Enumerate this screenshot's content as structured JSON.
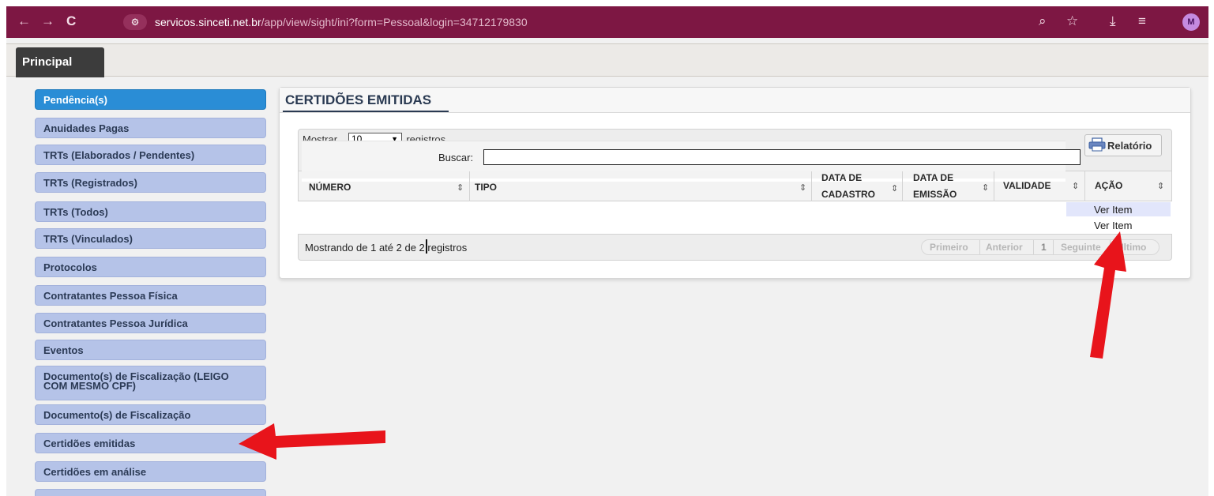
{
  "browser": {
    "url_host": "servicos.sinceti.net.br",
    "url_path": "/app/view/sight/ini?form=Pessoal&login=34712179830",
    "avatar_letter": "M",
    "colors": {
      "chrome": "#7d1743"
    }
  },
  "app": {
    "main_tab": "Principal"
  },
  "sidebar": {
    "items": [
      {
        "label": "Pendência(s)",
        "active": true
      },
      {
        "label": "Anuidades Pagas"
      },
      {
        "label": "TRTs (Elaborados / Pendentes)"
      },
      {
        "label": "TRTs (Registrados)"
      },
      {
        "label": "TRTs (Todos)"
      },
      {
        "label": "TRTs (Vinculados)"
      },
      {
        "label": "Protocolos"
      },
      {
        "label": "Contratantes Pessoa Física"
      },
      {
        "label": "Contratantes Pessoa Jurídica"
      },
      {
        "label": "Eventos"
      },
      {
        "label_line1": "Documento(s) de Fiscalização (LEIGO",
        "label_line2": "COM MESMO CPF)"
      },
      {
        "label": "Documento(s) de Fiscalização"
      },
      {
        "label": "Certidões emitidas"
      },
      {
        "label": "Certidões em análise"
      }
    ]
  },
  "panel": {
    "title": "CERTIDÕES EMITIDAS",
    "show_prefix": "Mostrar",
    "show_value": "10",
    "show_suffix": "registros",
    "search_label": "Buscar:",
    "search_value": "",
    "report_button": "Relatório",
    "columns": [
      {
        "label": "NÚMERO"
      },
      {
        "label": "TIPO"
      },
      {
        "label_line1": "DATA DE",
        "label_line2": "CADASTRO"
      },
      {
        "label_line1": "DATA DE",
        "label_line2": "EMISSÃO"
      },
      {
        "label": "VALIDADE"
      },
      {
        "label": "AÇÃO"
      }
    ],
    "rows": [
      {
        "action": "Ver Item"
      },
      {
        "action": "Ver Item"
      }
    ],
    "info": "Mostrando de 1 até 2 de 2 registros",
    "pagination": {
      "first": "Primeiro",
      "previous": "Anterior",
      "current": "1",
      "next": "Seguinte",
      "last": "Último"
    }
  },
  "annotations": {
    "arrow_color": "#e8141b"
  }
}
